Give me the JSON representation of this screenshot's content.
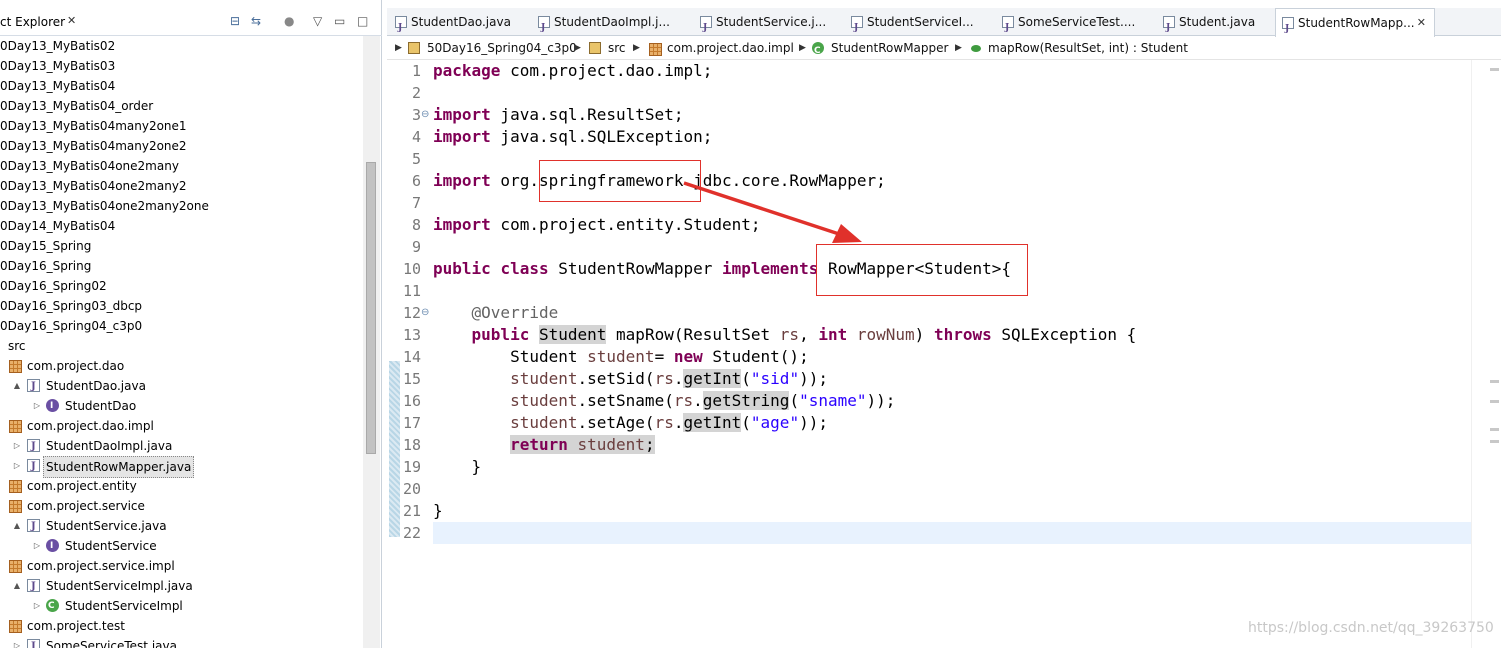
{
  "explorer": {
    "title": "ct Explorer",
    "close": "✕",
    "items": [
      {
        "label": "0Day13_MyBatis02",
        "type": "project"
      },
      {
        "label": "0Day13_MyBatis03",
        "type": "project"
      },
      {
        "label": "0Day13_MyBatis04",
        "type": "project"
      },
      {
        "label": "0Day13_MyBatis04_order",
        "type": "project"
      },
      {
        "label": "0Day13_MyBatis04many2one1",
        "type": "project"
      },
      {
        "label": "0Day13_MyBatis04many2one2",
        "type": "project"
      },
      {
        "label": "0Day13_MyBatis04one2many",
        "type": "project"
      },
      {
        "label": "0Day13_MyBatis04one2many2",
        "type": "project"
      },
      {
        "label": "0Day13_MyBatis04one2many2one",
        "type": "project"
      },
      {
        "label": "0Day14_MyBatis04",
        "type": "project"
      },
      {
        "label": "0Day15_Spring",
        "type": "project"
      },
      {
        "label": "0Day16_Spring",
        "type": "project"
      },
      {
        "label": "0Day16_Spring02",
        "type": "project"
      },
      {
        "label": "0Day16_Spring03_dbcp",
        "type": "project"
      },
      {
        "label": "0Day16_Spring04_c3p0",
        "type": "project"
      },
      {
        "label": "src",
        "type": "src"
      },
      {
        "label": "com.project.dao",
        "type": "package"
      },
      {
        "label": "StudentDao.java",
        "type": "java",
        "twisty": "▲"
      },
      {
        "label": "StudentDao",
        "type": "interface",
        "twisty": "▷"
      },
      {
        "label": "com.project.dao.impl",
        "type": "package"
      },
      {
        "label": "StudentDaoImpl.java",
        "type": "java",
        "twisty": "▷"
      },
      {
        "label": "StudentRowMapper.java",
        "type": "java",
        "twisty": "▷"
      },
      {
        "label": "com.project.entity",
        "type": "package"
      },
      {
        "label": "com.project.service",
        "type": "package"
      },
      {
        "label": "StudentService.java",
        "type": "java",
        "twisty": "▲"
      },
      {
        "label": "StudentService",
        "type": "interface",
        "twisty": "▷"
      },
      {
        "label": "com.project.service.impl",
        "type": "package"
      },
      {
        "label": "StudentServiceImpl.java",
        "type": "java",
        "twisty": "▲"
      },
      {
        "label": "StudentServiceImpl",
        "type": "class",
        "twisty": "▷"
      },
      {
        "label": "com.project.test",
        "type": "package"
      },
      {
        "label": "SomeServiceTest.java",
        "type": "java",
        "twisty": "▷"
      }
    ]
  },
  "tabs": [
    {
      "label": "StudentDao.java"
    },
    {
      "label": "StudentDaoImpl.j..."
    },
    {
      "label": "StudentService.j..."
    },
    {
      "label": "StudentServiceI..."
    },
    {
      "label": "SomeServiceTest...."
    },
    {
      "label": "Student.java"
    },
    {
      "label": "StudentRowMapp...",
      "close": "✕"
    }
  ],
  "breadcrumb": {
    "project": "50Day16_Spring04_c3p0",
    "src": "src",
    "package": "com.project.dao.impl",
    "class": "StudentRowMapper",
    "method": "mapRow(ResultSet, int) : Student"
  },
  "code": {
    "line_numbers": [
      "1",
      "2",
      "3",
      "4",
      "5",
      "6",
      "7",
      "8",
      "9",
      "10",
      "11",
      "12",
      "13",
      "14",
      "15",
      "16",
      "17",
      "18",
      "19",
      "20",
      "21",
      "22"
    ]
  },
  "watermark": "https://blog.csdn.net/qq_39263750",
  "colors": {
    "keyword": "#7f0055",
    "string": "#2a00ff",
    "annotation_box": "#e0312b"
  }
}
